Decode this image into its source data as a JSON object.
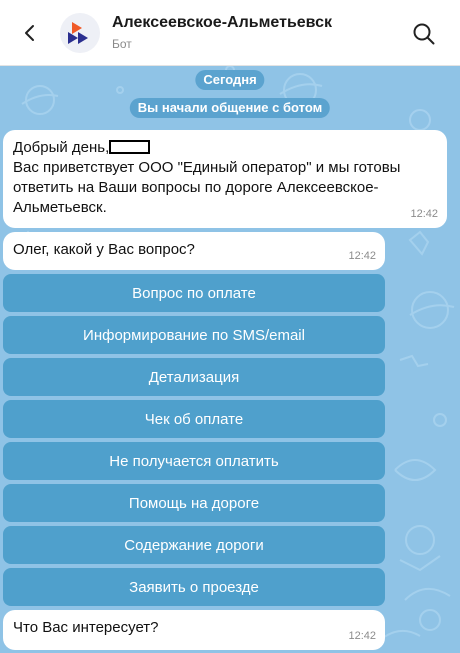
{
  "header": {
    "title": "Алексеевское-Альметьевск",
    "subtitle": "Бот"
  },
  "service": {
    "date": "Сегодня",
    "started": "Вы начали общение с ботом"
  },
  "messages": [
    {
      "line1": "Добрый день,",
      "body": "Вас приветствует ООО \"Единый оператор\" и мы готовы ответить на Ваши вопросы по дороге Алексеевское-Альметьевск.",
      "time": "12:42"
    },
    {
      "text": "Олег, какой у Вас вопрос?",
      "time": "12:42"
    },
    {
      "text": "Что Вас интересует?",
      "time": "12:42"
    }
  ],
  "keyboard": [
    "Вопрос по оплате",
    "Информирование по SMS/email",
    "Детализация",
    "Чек об оплате",
    "Не получается оплатить",
    "Помощь на дороге",
    "Содержание дороги",
    "Заявить о проезде"
  ],
  "colors": {
    "background": "#8fc3e6",
    "button": "#3e96c4",
    "pill": "#5ba3cf",
    "logo_orange": "#f05a28",
    "logo_blue": "#2b2f8f"
  }
}
